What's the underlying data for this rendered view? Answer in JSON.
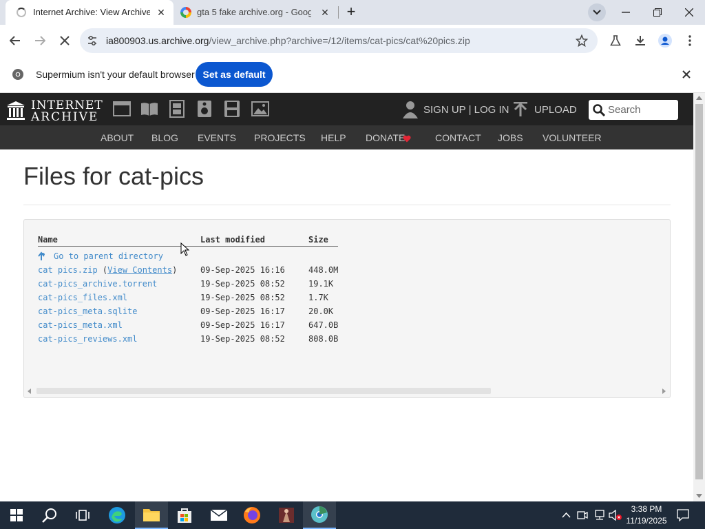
{
  "browser": {
    "tabs": [
      {
        "title": "Internet Archive: View Archive",
        "active": true
      },
      {
        "title": "gta 5 fake archive.org - Google",
        "active": false
      }
    ],
    "url_host": "ia800903.us.archive.org",
    "url_path": "/view_archive.php?archive=/12/items/cat-pics/cat%20pics.zip",
    "infobar_message": "Supermium isn't your default browser",
    "infobar_button": "Set as default"
  },
  "ia": {
    "logo_line1": "INTERNET",
    "logo_line2": "ARCHIVE",
    "account_text": "SIGN UP | LOG IN",
    "upload_text": "UPLOAD",
    "search_placeholder": "Search",
    "nav": [
      "ABOUT",
      "BLOG",
      "EVENTS",
      "PROJECTS",
      "HELP",
      "DONATE",
      "CONTACT",
      "JOBS",
      "VOLUNTEER"
    ]
  },
  "page": {
    "title": "Files for cat-pics",
    "columns": [
      "Name",
      "Last modified",
      "Size"
    ],
    "parent_link": "Go to parent directory",
    "files": [
      {
        "name": "cat pics.zip",
        "extra": "View Contents",
        "modified": "09-Sep-2025 16:16",
        "size": "448.0M"
      },
      {
        "name": "cat-pics_archive.torrent",
        "modified": "19-Sep-2025 08:52",
        "size": "19.1K"
      },
      {
        "name": "cat-pics_files.xml",
        "modified": "19-Sep-2025 08:52",
        "size": "1.7K"
      },
      {
        "name": "cat-pics_meta.sqlite",
        "modified": "09-Sep-2025 16:17",
        "size": "20.0K"
      },
      {
        "name": "cat-pics_meta.xml",
        "modified": "09-Sep-2025 16:17",
        "size": "647.0B"
      },
      {
        "name": "cat-pics_reviews.xml",
        "modified": "19-Sep-2025 08:52",
        "size": "808.0B"
      }
    ]
  },
  "taskbar": {
    "time": "3:38 PM",
    "date": "11/19/2025"
  },
  "colors": {
    "ia_link": "#428bca",
    "chrome_blue": "#0b57d0",
    "donate_heart": "#e32636"
  }
}
